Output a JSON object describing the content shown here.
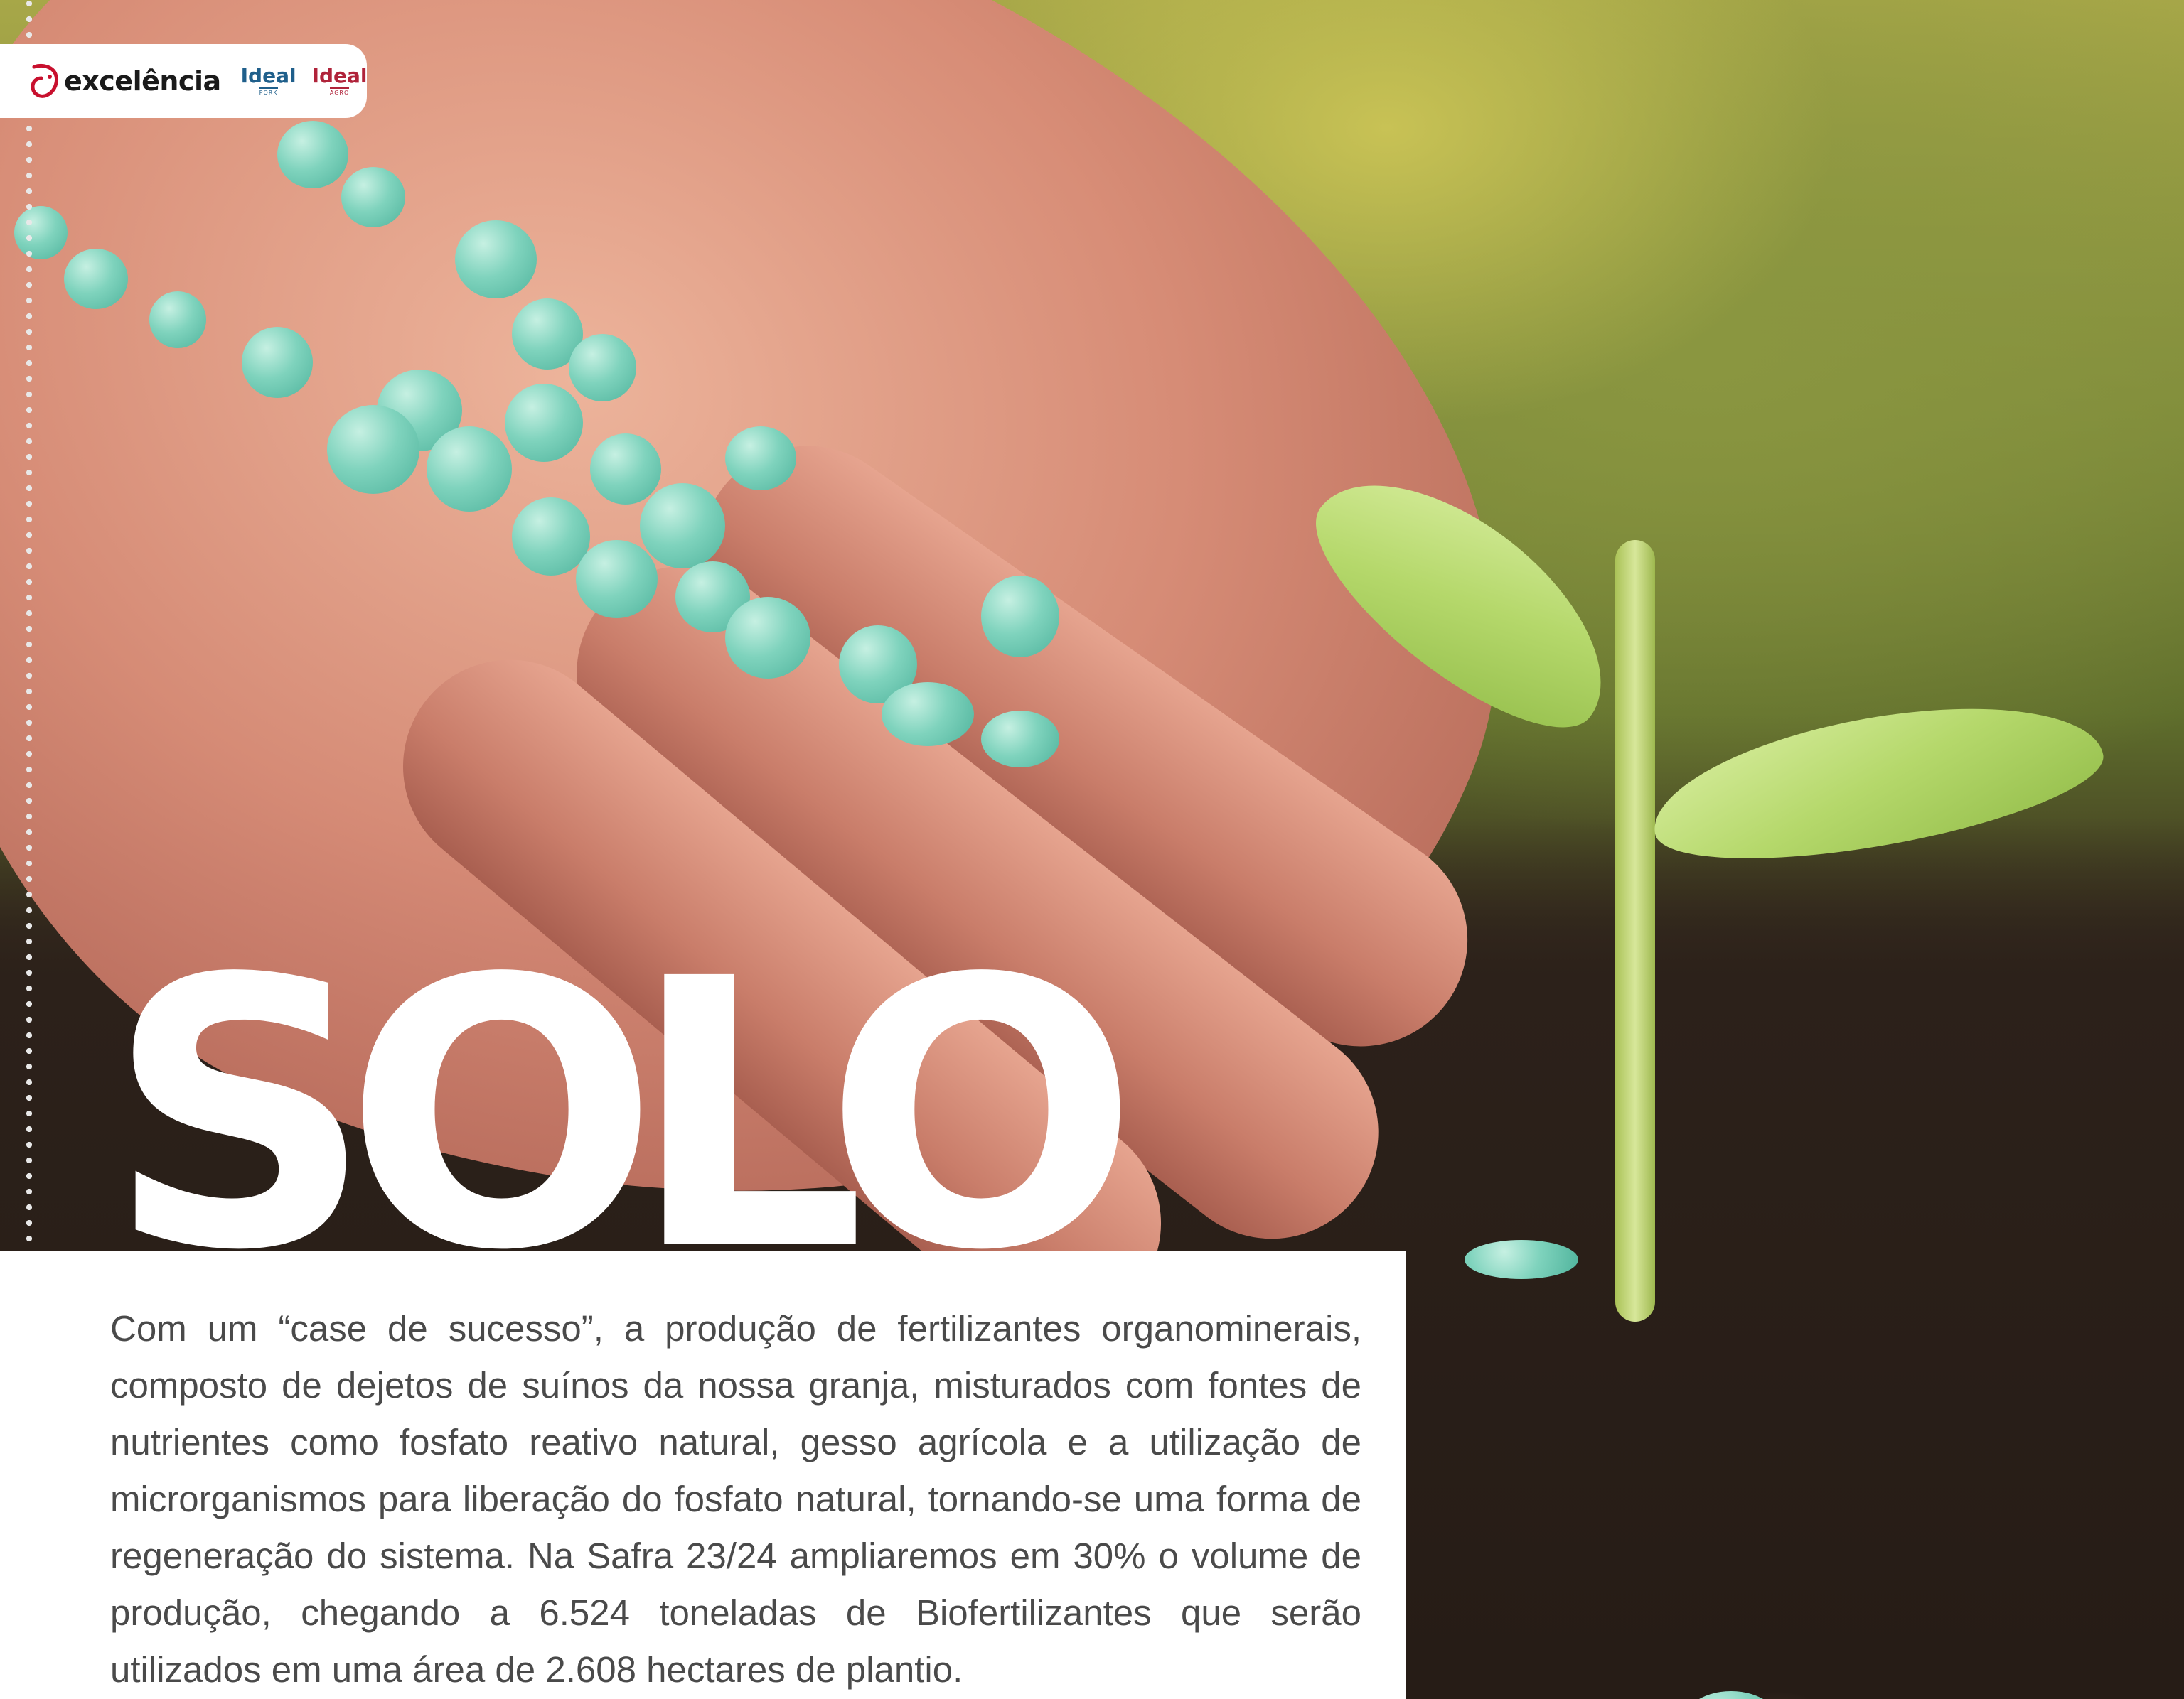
{
  "brand": {
    "main_logo_text": "excelência",
    "sub_logos": [
      {
        "name": "Ideal",
        "tag": "PORK",
        "color": "#1f5f8b"
      },
      {
        "name": "Ideal",
        "tag": "AGRO",
        "color": "#b0233a"
      }
    ]
  },
  "article": {
    "headline": "SOLO",
    "body": "Com um “case de sucesso”, a produção de fertilizantes organominerais, composto de dejetos de suínos da nossa granja, misturados com fontes de nutrientes como fosfato reativo natural, gesso agrícola e a utilização de microrganismos para liberação do fosfato natural, tornando-se uma forma de regeneração do sistema. Na Safra 23/24 ampliaremos em 30% o volume de produção, chegando a 6.524 toneladas de Biofertilizantes que serão utilizados em uma área de 2.608 hectares de plantio."
  },
  "colors": {
    "headline": "#ffffff",
    "body_text": "#4a4a4a",
    "granules": "#7fd3bd",
    "leaf": "#b5d86b"
  }
}
